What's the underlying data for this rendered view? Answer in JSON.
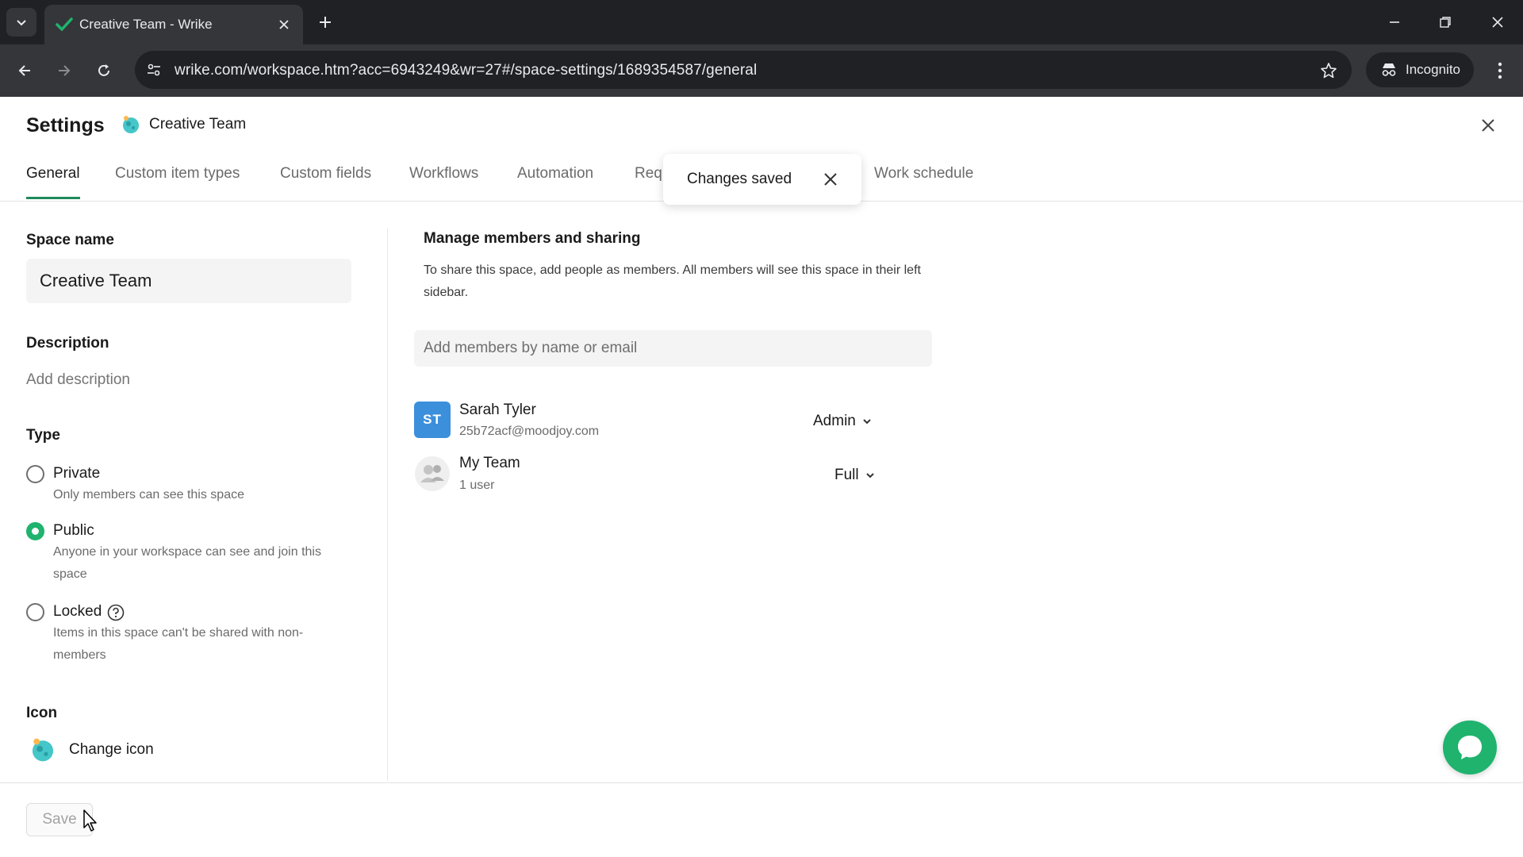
{
  "browser": {
    "tab_title": "Creative Team - Wrike",
    "url": "wrike.com/workspace.htm?acc=6943249&wr=27#/space-settings/1689354587/general",
    "incognito_label": "Incognito"
  },
  "header": {
    "title": "Settings",
    "space_name": "Creative Team"
  },
  "tabs": [
    {
      "label": "General",
      "active": true
    },
    {
      "label": "Custom item types"
    },
    {
      "label": "Custom fields"
    },
    {
      "label": "Workflows"
    },
    {
      "label": "Automation"
    },
    {
      "label": "Req"
    },
    {
      "label": "Work schedule"
    }
  ],
  "toast": {
    "text": "Changes saved"
  },
  "general": {
    "space_name_label": "Space name",
    "space_name_value": "Creative Team",
    "description_label": "Description",
    "description_placeholder": "Add description",
    "type_label": "Type",
    "types": [
      {
        "label": "Private",
        "desc": "Only members can see this space",
        "checked": false
      },
      {
        "label": "Public",
        "desc": "Anyone in your workspace can see and join this space",
        "checked": true
      },
      {
        "label": "Locked",
        "desc": "Items in this space can't be shared with non-members",
        "checked": false
      }
    ],
    "icon_label": "Icon",
    "change_icon": "Change icon"
  },
  "members": {
    "title": "Manage members and sharing",
    "description": "To share this space, add people as members. All members will see this space in their left sidebar.",
    "add_placeholder": "Add members by name or email",
    "list": [
      {
        "initials": "ST",
        "name": "Sarah Tyler",
        "sub": "25b72acf@moodjoy.com",
        "role": "Admin"
      },
      {
        "initials": "",
        "name": "My Team",
        "sub": "1 user",
        "role": "Full"
      }
    ]
  },
  "footer": {
    "save_label": "Save"
  },
  "colors": {
    "accent": "#1fb36e",
    "avatar_blue": "#3c8fdb",
    "chrome_dark": "#202124",
    "chrome_toolbar": "#35363a"
  }
}
